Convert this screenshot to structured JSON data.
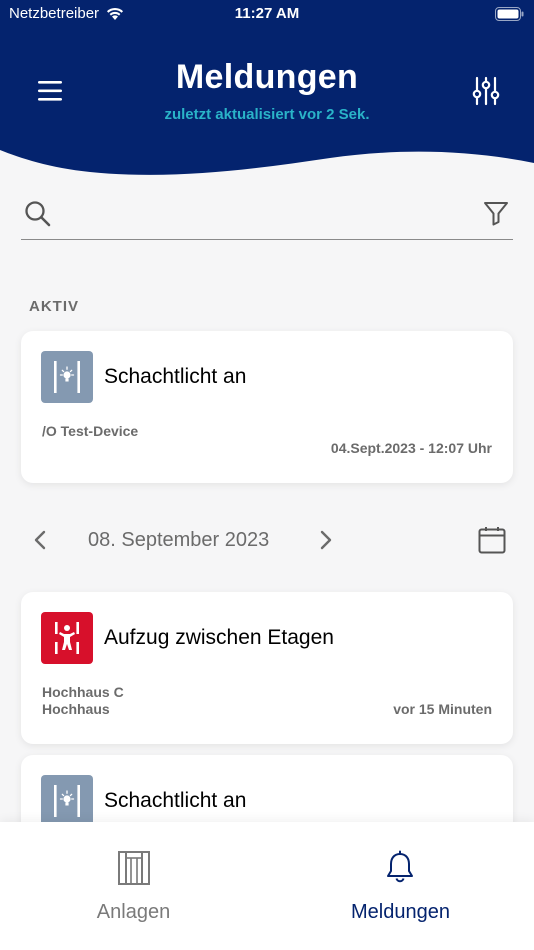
{
  "status_bar": {
    "carrier": "Netzbetreiber",
    "time": "11:27 AM"
  },
  "header": {
    "title": "Meldungen",
    "subtitle": "zuletzt aktualisiert vor 2 Sek.",
    "background": "#04236e",
    "accent": "#2ab3c8"
  },
  "search": {
    "placeholder": "",
    "value": ""
  },
  "active_section": {
    "label": "AKTIV",
    "items": [
      {
        "title": "Schachtlicht an",
        "icon": "shaft-light-icon",
        "icon_color": "#8499b1",
        "location": "/O Test-Device",
        "timestamp": "04.Sept.2023 - 12:07 Uhr"
      }
    ]
  },
  "date_nav": {
    "date": "08. September 2023"
  },
  "messages": [
    {
      "title": "Aufzug zwischen Etagen",
      "icon": "elevator-stuck-icon",
      "icon_color": "#d7102b",
      "line1": "Hochhaus C",
      "line2": "Hochhaus",
      "time": "vor 15 Minuten"
    },
    {
      "title": "Schachtlicht an",
      "icon": "shaft-light-icon",
      "icon_color": "#8499b1"
    }
  ],
  "tabbar": {
    "tabs": [
      {
        "label": "Anlagen",
        "icon": "elevator-icon",
        "active": false
      },
      {
        "label": "Meldungen",
        "icon": "bell-icon",
        "active": true
      }
    ],
    "active_color": "#04236e",
    "inactive_color": "#7a7a7a"
  }
}
